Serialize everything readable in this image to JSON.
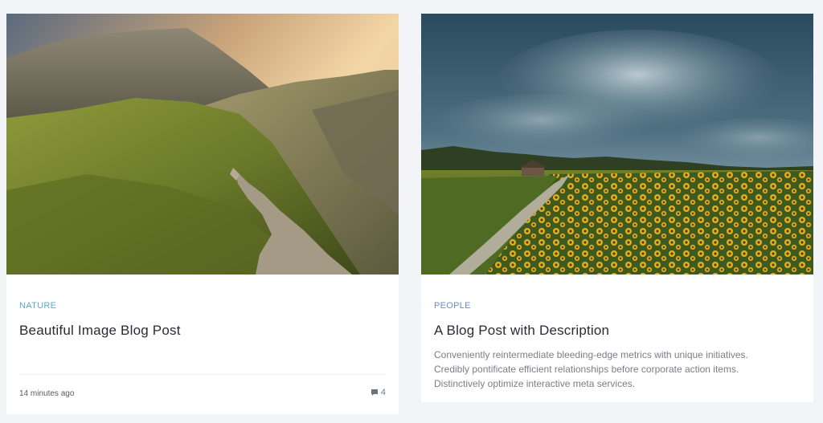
{
  "posts": [
    {
      "image": "mountain-trail-image",
      "category": "NATURE",
      "title": "Beautiful Image Blog Post",
      "timestamp": "14 minutes ago",
      "comment_count": "4",
      "comment_icon": "comment-icon"
    },
    {
      "image": "sunflower-field-image",
      "category": "PEOPLE",
      "title": "A Blog Post with Description",
      "description_lines": [
        "Conveniently reintermediate bleeding-edge metrics with unique initiatives.",
        "Credibly pontificate efficient relationships before corporate action items.",
        "Distinctively optimize interactive meta services."
      ]
    }
  ],
  "colors": {
    "background": "#f3f4f8",
    "card": "#ffffff",
    "category_nature": "#5aa9c8",
    "category_people": "#6d8cc4",
    "title": "#2b2b33",
    "text_muted": "#7b7e88"
  }
}
